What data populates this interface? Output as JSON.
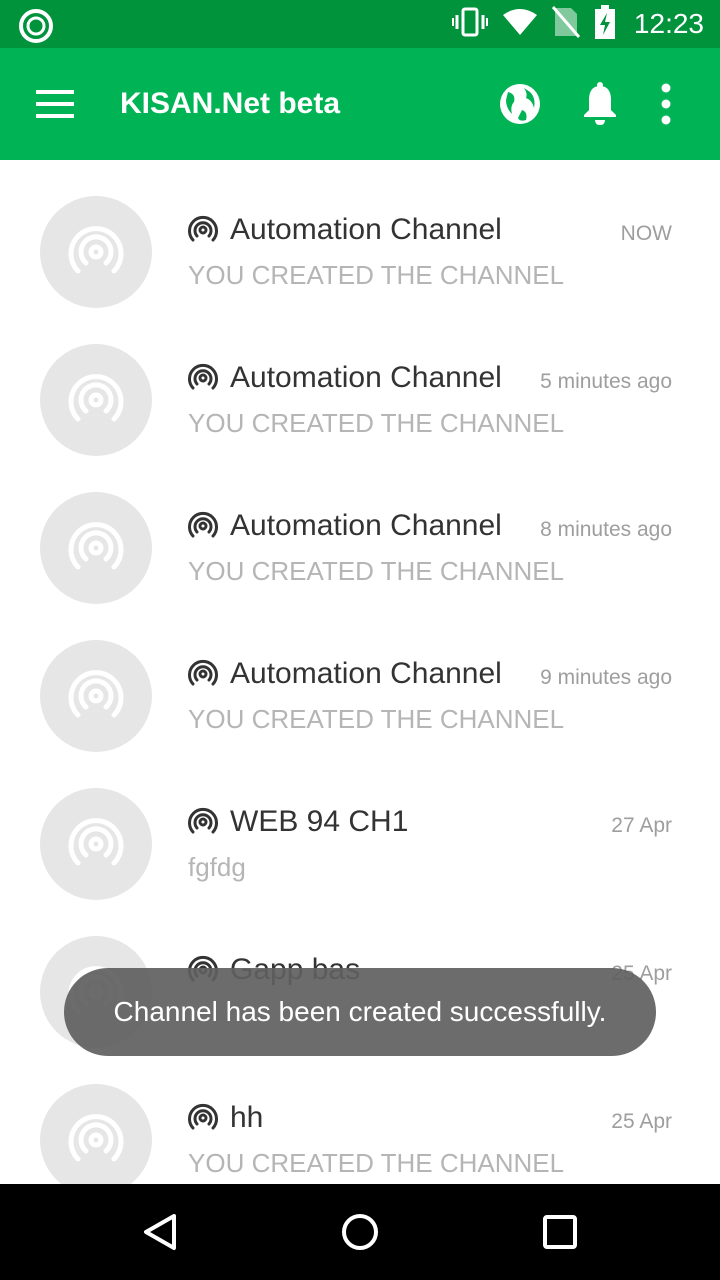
{
  "status_bar": {
    "time": "12:23",
    "icons": [
      "app-circle-icon",
      "vibrate-icon",
      "wifi-icon",
      "no-sim-icon",
      "battery-charging-icon"
    ]
  },
  "app_bar": {
    "title": "KISAN.Net beta",
    "icons": [
      "menu-icon",
      "globe-icon",
      "bell-icon",
      "more-vert-icon"
    ]
  },
  "channels": [
    {
      "name": "Automation Channel",
      "time": "NOW",
      "subtitle": "YOU CREATED THE CHANNEL"
    },
    {
      "name": "Automation Channel",
      "time": "5 minutes ago",
      "subtitle": "YOU CREATED THE CHANNEL"
    },
    {
      "name": "Automation Channel",
      "time": "8 minutes ago",
      "subtitle": "YOU CREATED THE CHANNEL"
    },
    {
      "name": "Automation Channel",
      "time": "9 minutes ago",
      "subtitle": "YOU CREATED THE CHANNEL"
    },
    {
      "name": "WEB 94 CH1",
      "time": "27 Apr",
      "subtitle": "fgfdg"
    },
    {
      "name": "Gapp bas",
      "time": "25 Apr",
      "subtitle": ""
    },
    {
      "name": "hh",
      "time": "25 Apr",
      "subtitle": "YOU CREATED THE CHANNEL"
    }
  ],
  "toast": {
    "message": "Channel has been created successfully."
  },
  "colors": {
    "primary": "#00b355",
    "primary_dark": "#00933c",
    "toast_bg": "#606060"
  }
}
